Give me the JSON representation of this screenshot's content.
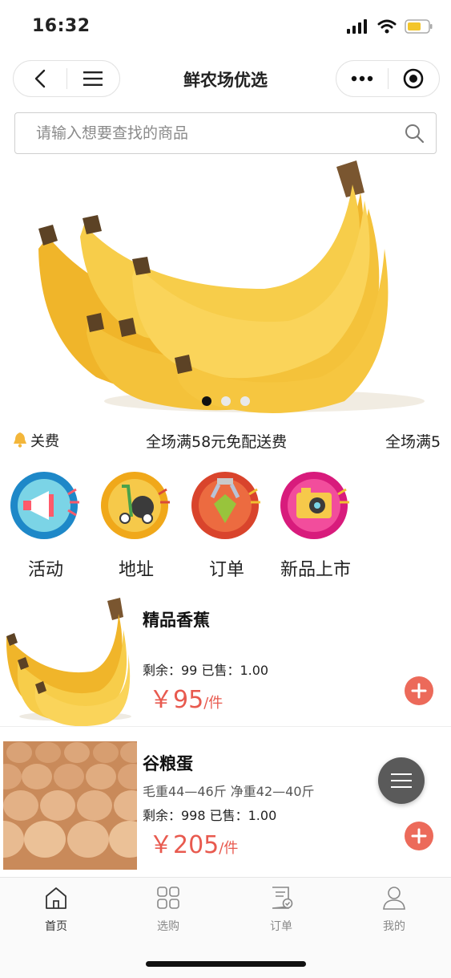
{
  "status": {
    "time": "16:32"
  },
  "nav": {
    "title": "鲜农场优选"
  },
  "search": {
    "placeholder": "请输入想要查找的商品"
  },
  "notice": {
    "label": "关费",
    "text": "全场满58元免配送费",
    "text_repeat": "全场满5"
  },
  "categories": [
    {
      "label": "活动",
      "icon": "megaphone-icon",
      "ring_color": "#1e88c8",
      "inner_color": "#7bd4e6"
    },
    {
      "label": "地址",
      "icon": "scooter-icon",
      "ring_color": "#f0a81a",
      "inner_color": "#f6c94a"
    },
    {
      "label": "订单",
      "icon": "claw-machine-icon",
      "ring_color": "#d9442c",
      "inner_color": "#ec6b40"
    },
    {
      "label": "新品上市",
      "icon": "camera-icon",
      "ring_color": "#d81b7c",
      "inner_color": "#f24d9c"
    }
  ],
  "products": [
    {
      "name": "精品香蕉",
      "spec": "",
      "stock": "剩余：99 已售：1.00",
      "price": "￥95",
      "unit": "/件"
    },
    {
      "name": "谷粮蛋",
      "spec": "毛重44—46斤 净重42—40斤",
      "stock": "剩余：998 已售：1.00",
      "price": "￥205",
      "unit": "/件"
    }
  ],
  "tabs": [
    {
      "label": "首页",
      "icon": "home-icon"
    },
    {
      "label": "选购",
      "icon": "grid-icon"
    },
    {
      "label": "订单",
      "icon": "order-icon"
    },
    {
      "label": "我的",
      "icon": "user-icon"
    }
  ],
  "colors": {
    "price": "#e85a4f",
    "accent": "#ec6a5a",
    "banana": "#f5c33b",
    "bell": "#f3b63a"
  }
}
